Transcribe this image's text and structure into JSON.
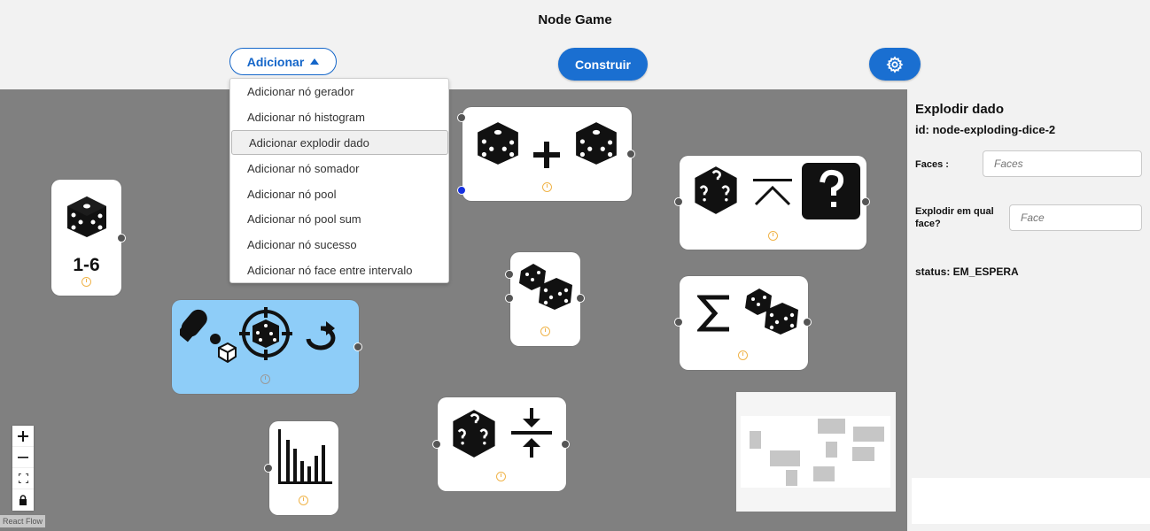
{
  "header": {
    "title": "Node Game",
    "add_button_label": "Adicionar",
    "build_button_label": "Construir",
    "settings_icon": "gear-icon"
  },
  "add_menu": {
    "items": [
      "Adicionar nó gerador",
      "Adicionar nó histogram",
      "Adicionar explodir dado",
      "Adicionar nó somador",
      "Adicionar nó pool",
      "Adicionar nó pool sum",
      "Adicionar nó sucesso",
      "Adicionar nó face entre intervalo"
    ],
    "highlighted_index": 2
  },
  "nodes": {
    "generator": {
      "label": "1-6",
      "icons": [
        "die-icon"
      ]
    },
    "sum_dice": {
      "icons": [
        "die-icon",
        "plus-icon",
        "die-icon"
      ]
    },
    "exploding_dice": {
      "icons": [
        "mystery-die-icon",
        "caret-up-icon",
        "question-mark-icon"
      ]
    },
    "pool": {
      "icons": [
        "two-dice-icon"
      ]
    },
    "pool_sum": {
      "icons": [
        "sigma-icon",
        "two-dice-icon"
      ]
    },
    "success": {
      "icons": [
        "cannon-icon",
        "target-die-icon",
        "reroll-icon"
      ],
      "selected": true
    },
    "histogram": {
      "icons": [
        "bar-chart-icon"
      ]
    },
    "face_interval": {
      "icons": [
        "mystery-die-icon",
        "interval-icon"
      ]
    }
  },
  "controls": [
    "zoom-in",
    "zoom-out",
    "fit-view",
    "lock"
  ],
  "attribution": "React Flow",
  "panel": {
    "title": "Explodir dado",
    "id_text": "id: node-exploding-dice-2",
    "faces_label": "Faces :",
    "faces_placeholder": "Faces",
    "explode_label_line1": "Explodir em qual",
    "explode_label_line2": "face?",
    "explode_placeholder": "Face",
    "status": "status: EM_ESPERA"
  },
  "colors": {
    "accent": "#1a6fd1",
    "canvas": "#808080",
    "selected_node": "#8ecdf8",
    "clock": "#f0b44a"
  }
}
